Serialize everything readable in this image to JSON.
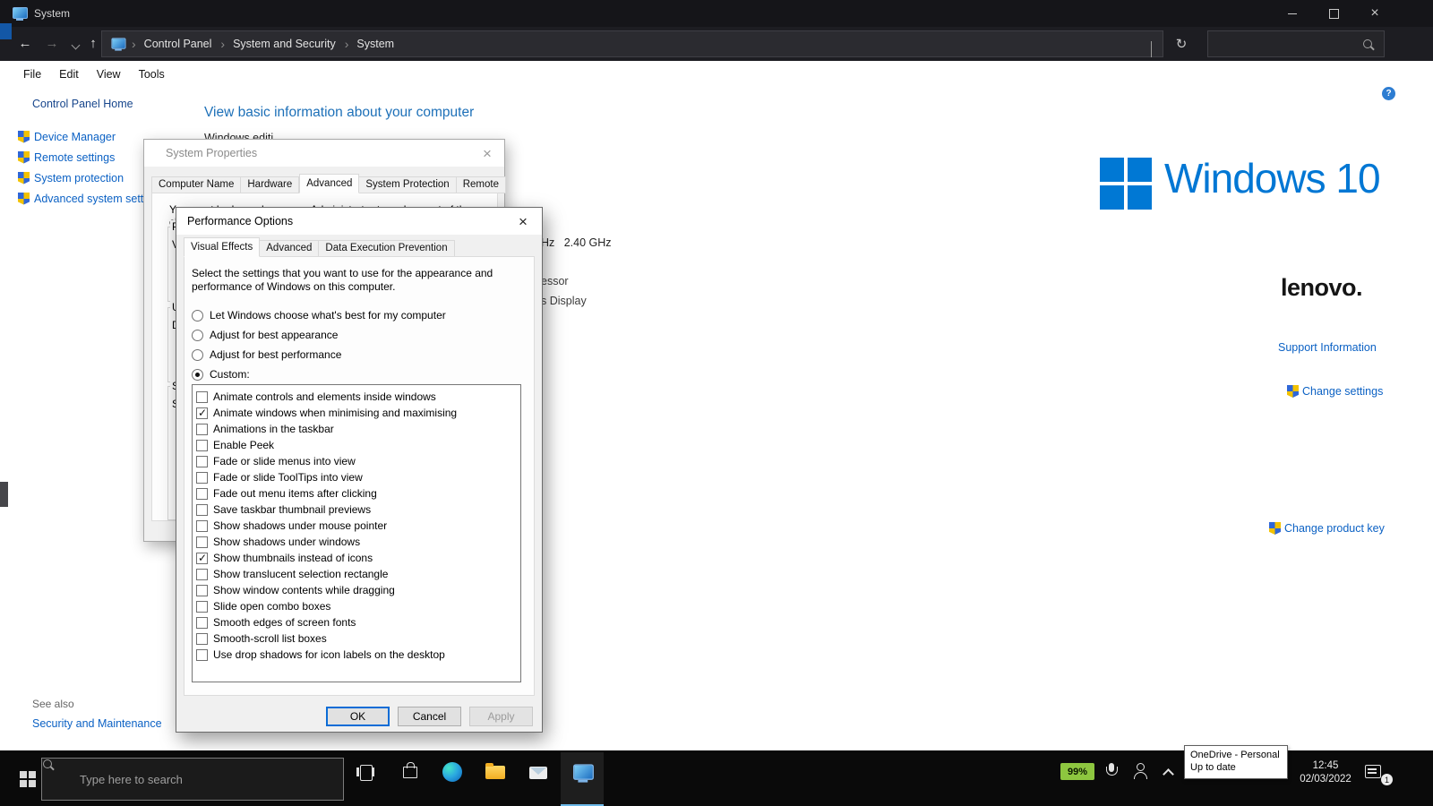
{
  "window": {
    "title": "System"
  },
  "navbar": {
    "breadcrumb": [
      {
        "label": "Control Panel"
      },
      {
        "label": "System and Security"
      },
      {
        "label": "System"
      }
    ],
    "search_value": ""
  },
  "menubar": {
    "items": [
      {
        "label": "File"
      },
      {
        "label": "Edit"
      },
      {
        "label": "View"
      },
      {
        "label": "Tools"
      }
    ]
  },
  "sidebar": {
    "home": "Control Panel Home",
    "items": [
      {
        "label": "Device Manager"
      },
      {
        "label": "Remote settings"
      },
      {
        "label": "System protection"
      },
      {
        "label": "Advanced system settings"
      }
    ],
    "see_also": "See also",
    "see_also_link": "Security and Maintenance"
  },
  "content": {
    "heading": "View basic information about your computer",
    "edition_fragment": "Windows editi",
    "cpu_fragment": "Hz   2.40 GHz",
    "processor_fragment": "essor",
    "display_fragment": "s Display",
    "windows_logo_text": "Windows 10",
    "lenovo_logo_text": "lenovo.",
    "support_link": "Support Information",
    "change_settings_link": "Change settings",
    "change_product_key_link": "Change product key"
  },
  "system_properties": {
    "title": "System Properties",
    "tabs": [
      {
        "label": "Computer Name"
      },
      {
        "label": "Hardware"
      },
      {
        "label": "Advanced",
        "active": true
      },
      {
        "label": "System Protection"
      },
      {
        "label": "Remote"
      }
    ],
    "admin_note": "You must be logged on as an Administrator to make most of these changes.",
    "fragments": [
      "P",
      "V",
      "U",
      "D",
      "S",
      "S"
    ]
  },
  "performance_options": {
    "title": "Performance Options",
    "tabs": [
      {
        "label": "Visual Effects",
        "active": true
      },
      {
        "label": "Advanced"
      },
      {
        "label": "Data Execution Prevention"
      }
    ],
    "description": "Select the settings that you want to use for the appearance and performance of Windows on this computer.",
    "radio_options": [
      {
        "label": "Let Windows choose what's best for my computer",
        "selected": false
      },
      {
        "label": "Adjust for best appearance",
        "selected": false
      },
      {
        "label": "Adjust for best performance",
        "selected": false
      },
      {
        "label": "Custom:",
        "selected": true
      }
    ],
    "visual_effects": [
      {
        "label": "Animate controls and elements inside windows",
        "checked": false
      },
      {
        "label": "Animate windows when minimising and maximising",
        "checked": true
      },
      {
        "label": "Animations in the taskbar",
        "checked": false
      },
      {
        "label": "Enable Peek",
        "checked": false
      },
      {
        "label": "Fade or slide menus into view",
        "checked": false
      },
      {
        "label": "Fade or slide ToolTips into view",
        "checked": false
      },
      {
        "label": "Fade out menu items after clicking",
        "checked": false
      },
      {
        "label": "Save taskbar thumbnail previews",
        "checked": false
      },
      {
        "label": "Show shadows under mouse pointer",
        "checked": false
      },
      {
        "label": "Show shadows under windows",
        "checked": false
      },
      {
        "label": "Show thumbnails instead of icons",
        "checked": true
      },
      {
        "label": "Show translucent selection rectangle",
        "checked": false
      },
      {
        "label": "Show window contents while dragging",
        "checked": false
      },
      {
        "label": "Slide open combo boxes",
        "checked": false
      },
      {
        "label": "Smooth edges of screen fonts",
        "checked": false
      },
      {
        "label": "Smooth-scroll list boxes",
        "checked": false
      },
      {
        "label": "Use drop shadows for icon labels on the desktop",
        "checked": false
      }
    ],
    "buttons": {
      "ok": "OK",
      "cancel": "Cancel",
      "apply": "Apply",
      "apply_disabled": true
    }
  },
  "taskbar": {
    "search_placeholder": "Type here to search",
    "battery_percent": "99%",
    "onedrive_tooltip": {
      "title": "OneDrive - Personal",
      "status": "Up to date"
    },
    "clock_time": "12:45",
    "clock_date": "02/03/2022",
    "notification_badge": "1"
  }
}
